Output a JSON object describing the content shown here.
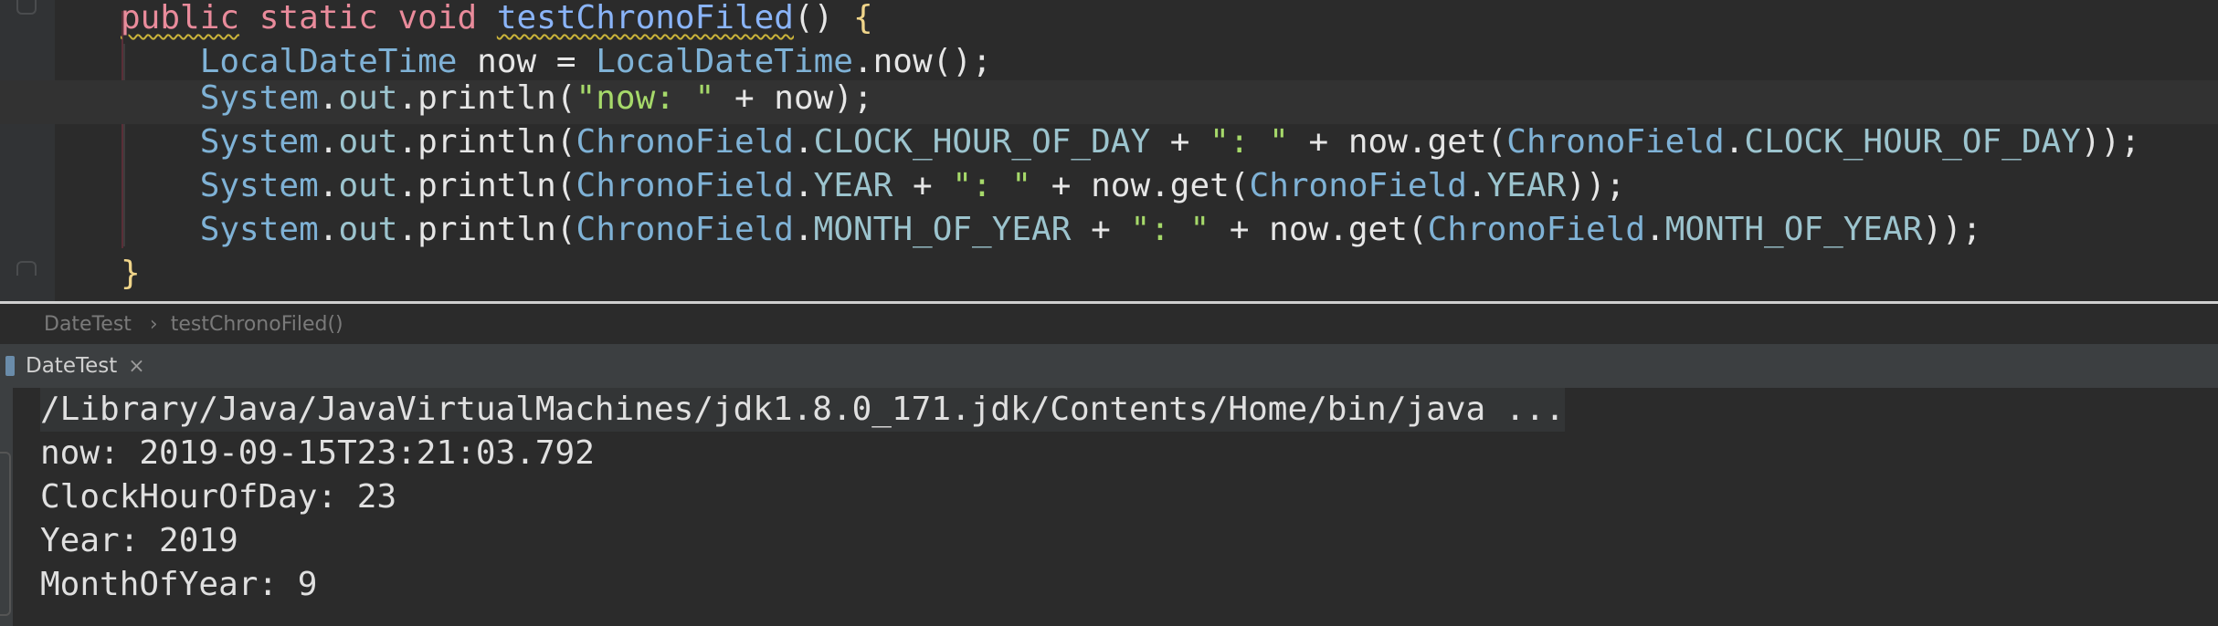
{
  "editor": {
    "lines": [
      {
        "tokens": [
          {
            "t": "public",
            "c": "kw",
            "sq": true
          },
          {
            "t": " ",
            "c": "plain"
          },
          {
            "t": "static",
            "c": "kw"
          },
          {
            "t": " ",
            "c": "plain"
          },
          {
            "t": "void",
            "c": "kw"
          },
          {
            "t": " ",
            "c": "plain"
          },
          {
            "t": "testChronoFiled",
            "c": "fn",
            "sq": true
          },
          {
            "t": "() ",
            "c": "plain"
          },
          {
            "t": "{",
            "c": "brace"
          }
        ]
      },
      {
        "tokens": [
          {
            "t": "    ",
            "c": "plain"
          },
          {
            "t": "LocalDateTime",
            "c": "type"
          },
          {
            "t": " now = ",
            "c": "plain"
          },
          {
            "t": "LocalDateTime",
            "c": "type"
          },
          {
            "t": ".now();",
            "c": "plain"
          }
        ]
      },
      {
        "current": true,
        "tokens": [
          {
            "t": "    ",
            "c": "plain"
          },
          {
            "t": "System",
            "c": "type"
          },
          {
            "t": ".",
            "c": "plain"
          },
          {
            "t": "out",
            "c": "field"
          },
          {
            "t": ".println(",
            "c": "plain"
          },
          {
            "t": "\"now: \"",
            "c": "str"
          },
          {
            "t": " + now);",
            "c": "plain"
          }
        ]
      },
      {
        "tokens": [
          {
            "t": "    ",
            "c": "plain"
          },
          {
            "t": "System",
            "c": "type"
          },
          {
            "t": ".",
            "c": "plain"
          },
          {
            "t": "out",
            "c": "field"
          },
          {
            "t": ".println(",
            "c": "plain"
          },
          {
            "t": "ChronoField",
            "c": "type"
          },
          {
            "t": ".",
            "c": "plain"
          },
          {
            "t": "CLOCK_HOUR_OF_DAY",
            "c": "field"
          },
          {
            "t": " + ",
            "c": "plain"
          },
          {
            "t": "\": \"",
            "c": "str"
          },
          {
            "t": " + now.get(",
            "c": "plain"
          },
          {
            "t": "ChronoField",
            "c": "type"
          },
          {
            "t": ".",
            "c": "plain"
          },
          {
            "t": "CLOCK_HOUR_OF_DAY",
            "c": "field"
          },
          {
            "t": "));",
            "c": "plain"
          }
        ]
      },
      {
        "tokens": [
          {
            "t": "    ",
            "c": "plain"
          },
          {
            "t": "System",
            "c": "type"
          },
          {
            "t": ".",
            "c": "plain"
          },
          {
            "t": "out",
            "c": "field"
          },
          {
            "t": ".println(",
            "c": "plain"
          },
          {
            "t": "ChronoField",
            "c": "type"
          },
          {
            "t": ".",
            "c": "plain"
          },
          {
            "t": "YEAR",
            "c": "field"
          },
          {
            "t": " + ",
            "c": "plain"
          },
          {
            "t": "\": \"",
            "c": "str"
          },
          {
            "t": " + now.get(",
            "c": "plain"
          },
          {
            "t": "ChronoField",
            "c": "type"
          },
          {
            "t": ".",
            "c": "plain"
          },
          {
            "t": "YEAR",
            "c": "field"
          },
          {
            "t": "));",
            "c": "plain"
          }
        ]
      },
      {
        "tokens": [
          {
            "t": "    ",
            "c": "plain"
          },
          {
            "t": "System",
            "c": "type"
          },
          {
            "t": ".",
            "c": "plain"
          },
          {
            "t": "out",
            "c": "field"
          },
          {
            "t": ".println(",
            "c": "plain"
          },
          {
            "t": "ChronoField",
            "c": "type"
          },
          {
            "t": ".",
            "c": "plain"
          },
          {
            "t": "MONTH_OF_YEAR",
            "c": "field"
          },
          {
            "t": " + ",
            "c": "plain"
          },
          {
            "t": "\": \"",
            "c": "str"
          },
          {
            "t": " + now.get(",
            "c": "plain"
          },
          {
            "t": "ChronoField",
            "c": "type"
          },
          {
            "t": ".",
            "c": "plain"
          },
          {
            "t": "MONTH_OF_YEAR",
            "c": "field"
          },
          {
            "t": "));",
            "c": "plain"
          }
        ]
      },
      {
        "tokens": [
          {
            "t": "}",
            "c": "brace"
          }
        ]
      }
    ]
  },
  "breadcrumb": {
    "class_name": "DateTest",
    "separator": "›",
    "method_name": "testChronoFiled()"
  },
  "run_panel": {
    "tab_label": "DateTest",
    "close_glyph": "×"
  },
  "console": {
    "lines": [
      "/Library/Java/JavaVirtualMachines/jdk1.8.0_171.jdk/Contents/Home/bin/java ...",
      "now: 2019-09-15T23:21:03.792",
      "ClockHourOfDay: 23",
      "Year: 2019",
      "MonthOfYear: 9"
    ]
  }
}
